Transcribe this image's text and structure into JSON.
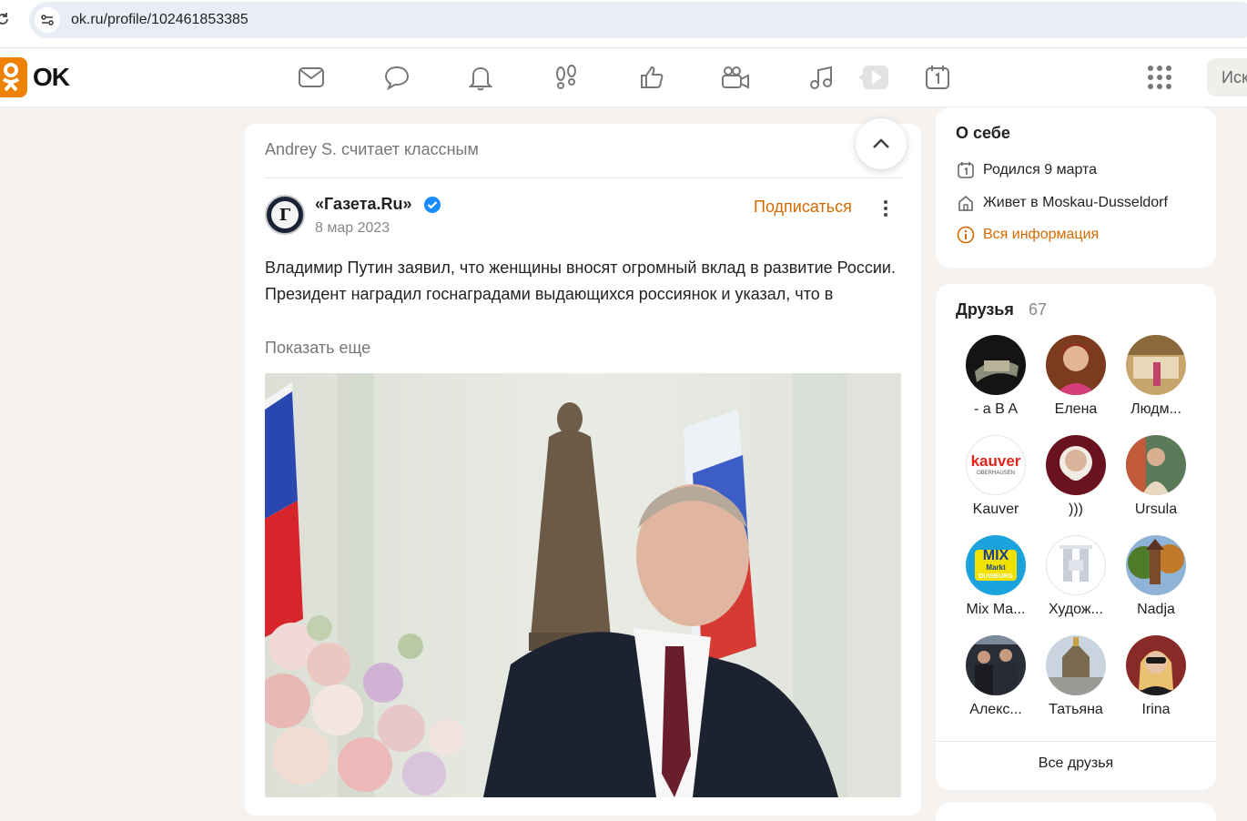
{
  "browser": {
    "url": "ok.ru/profile/102461853385"
  },
  "header": {
    "logo_text": "OK",
    "nav_icons": [
      "mail-icon",
      "chat-icon",
      "bell-icon",
      "footprints-icon",
      "like-icon",
      "video-camera-icon",
      "music-icon",
      "play-icon",
      "calendar-icon"
    ],
    "apps_icon": "grid-icon",
    "search_placeholder": "Иск"
  },
  "post": {
    "liked_by": "Andrey S. считает классным",
    "author": "«Газета.Ru»",
    "avatar_letter": "Г",
    "date": "8 мар 2023",
    "subscribe_label": "Подписаться",
    "text_line1": "Владимир Путин заявил, что женщины вносят огромный вклад в развитие России.",
    "text_line2": "Президент наградил госнаградами выдающихся россиянок и указал, что в",
    "show_more": "Показать еще"
  },
  "about": {
    "title": "О себе",
    "born": "Родился 9 марта",
    "lives": "Живет в Moskau-Dusseldorf",
    "all_info": "Вся информация"
  },
  "friends": {
    "title": "Друзья",
    "count": "67",
    "items": [
      {
        "name": "- a B A"
      },
      {
        "name": "Елена"
      },
      {
        "name": "Людм..."
      },
      {
        "name": "Kauver"
      },
      {
        "name": ")))"
      },
      {
        "name": "Ursula"
      },
      {
        "name": "Mix Ma..."
      },
      {
        "name": "Худож..."
      },
      {
        "name": "Nadja"
      },
      {
        "name": "Алекс..."
      },
      {
        "name": "Татьяна"
      },
      {
        "name": "Irina"
      }
    ],
    "kauver_logo_text": "kauver",
    "kauver_logo_sub": "OBERHAUSEN",
    "mix_logo_text": "MIX",
    "mix_logo_sub": "Markt",
    "mix_logo_city": "DUISBURG",
    "all_friends": "Все друзья"
  },
  "colors": {
    "brand_orange": "#ee8208",
    "link_orange": "#d56a00",
    "page_bg": "#f5f2ef",
    "verified_blue": "#1a8cff"
  }
}
